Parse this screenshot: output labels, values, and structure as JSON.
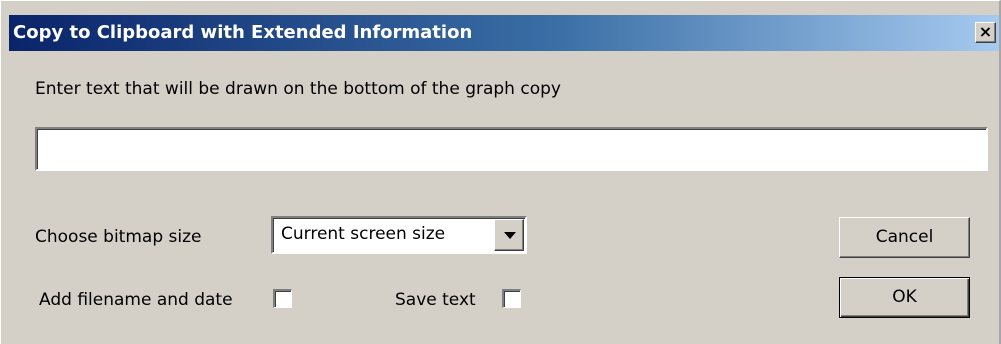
{
  "dialog": {
    "title": "Copy to Clipboard with Extended Information",
    "close_glyph": "✕"
  },
  "prompt": {
    "label": "Enter text that will be drawn on the bottom of the graph copy",
    "text_value": ""
  },
  "bitmap": {
    "label": "Choose bitmap size",
    "selected": "Current screen size"
  },
  "options": {
    "add_filename_label": "Add filename and date",
    "add_filename_checked": false,
    "save_text_label": "Save text",
    "save_text_checked": false
  },
  "buttons": {
    "cancel": "Cancel",
    "ok": "OK"
  },
  "colors": {
    "face": "#d4d0c8",
    "title_start": "#0a246a",
    "title_end": "#a6caf0"
  }
}
